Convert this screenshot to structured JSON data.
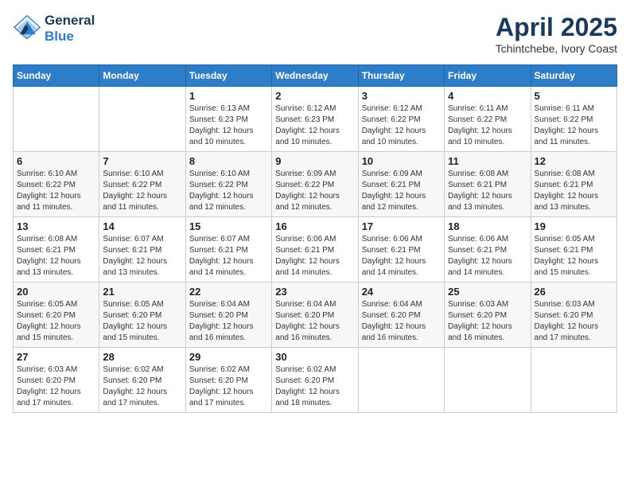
{
  "header": {
    "logo_line1": "General",
    "logo_line2": "Blue",
    "month": "April 2025",
    "location": "Tchintchebe, Ivory Coast"
  },
  "weekdays": [
    "Sunday",
    "Monday",
    "Tuesday",
    "Wednesday",
    "Thursday",
    "Friday",
    "Saturday"
  ],
  "weeks": [
    [
      {
        "day": "",
        "info": ""
      },
      {
        "day": "",
        "info": ""
      },
      {
        "day": "1",
        "info": "Sunrise: 6:13 AM\nSunset: 6:23 PM\nDaylight: 12 hours and 10 minutes."
      },
      {
        "day": "2",
        "info": "Sunrise: 6:12 AM\nSunset: 6:23 PM\nDaylight: 12 hours and 10 minutes."
      },
      {
        "day": "3",
        "info": "Sunrise: 6:12 AM\nSunset: 6:22 PM\nDaylight: 12 hours and 10 minutes."
      },
      {
        "day": "4",
        "info": "Sunrise: 6:11 AM\nSunset: 6:22 PM\nDaylight: 12 hours and 10 minutes."
      },
      {
        "day": "5",
        "info": "Sunrise: 6:11 AM\nSunset: 6:22 PM\nDaylight: 12 hours and 11 minutes."
      }
    ],
    [
      {
        "day": "6",
        "info": "Sunrise: 6:10 AM\nSunset: 6:22 PM\nDaylight: 12 hours and 11 minutes."
      },
      {
        "day": "7",
        "info": "Sunrise: 6:10 AM\nSunset: 6:22 PM\nDaylight: 12 hours and 11 minutes."
      },
      {
        "day": "8",
        "info": "Sunrise: 6:10 AM\nSunset: 6:22 PM\nDaylight: 12 hours and 12 minutes."
      },
      {
        "day": "9",
        "info": "Sunrise: 6:09 AM\nSunset: 6:22 PM\nDaylight: 12 hours and 12 minutes."
      },
      {
        "day": "10",
        "info": "Sunrise: 6:09 AM\nSunset: 6:21 PM\nDaylight: 12 hours and 12 minutes."
      },
      {
        "day": "11",
        "info": "Sunrise: 6:08 AM\nSunset: 6:21 PM\nDaylight: 12 hours and 13 minutes."
      },
      {
        "day": "12",
        "info": "Sunrise: 6:08 AM\nSunset: 6:21 PM\nDaylight: 12 hours and 13 minutes."
      }
    ],
    [
      {
        "day": "13",
        "info": "Sunrise: 6:08 AM\nSunset: 6:21 PM\nDaylight: 12 hours and 13 minutes."
      },
      {
        "day": "14",
        "info": "Sunrise: 6:07 AM\nSunset: 6:21 PM\nDaylight: 12 hours and 13 minutes."
      },
      {
        "day": "15",
        "info": "Sunrise: 6:07 AM\nSunset: 6:21 PM\nDaylight: 12 hours and 14 minutes."
      },
      {
        "day": "16",
        "info": "Sunrise: 6:06 AM\nSunset: 6:21 PM\nDaylight: 12 hours and 14 minutes."
      },
      {
        "day": "17",
        "info": "Sunrise: 6:06 AM\nSunset: 6:21 PM\nDaylight: 12 hours and 14 minutes."
      },
      {
        "day": "18",
        "info": "Sunrise: 6:06 AM\nSunset: 6:21 PM\nDaylight: 12 hours and 14 minutes."
      },
      {
        "day": "19",
        "info": "Sunrise: 6:05 AM\nSunset: 6:21 PM\nDaylight: 12 hours and 15 minutes."
      }
    ],
    [
      {
        "day": "20",
        "info": "Sunrise: 6:05 AM\nSunset: 6:20 PM\nDaylight: 12 hours and 15 minutes."
      },
      {
        "day": "21",
        "info": "Sunrise: 6:05 AM\nSunset: 6:20 PM\nDaylight: 12 hours and 15 minutes."
      },
      {
        "day": "22",
        "info": "Sunrise: 6:04 AM\nSunset: 6:20 PM\nDaylight: 12 hours and 16 minutes."
      },
      {
        "day": "23",
        "info": "Sunrise: 6:04 AM\nSunset: 6:20 PM\nDaylight: 12 hours and 16 minutes."
      },
      {
        "day": "24",
        "info": "Sunrise: 6:04 AM\nSunset: 6:20 PM\nDaylight: 12 hours and 16 minutes."
      },
      {
        "day": "25",
        "info": "Sunrise: 6:03 AM\nSunset: 6:20 PM\nDaylight: 12 hours and 16 minutes."
      },
      {
        "day": "26",
        "info": "Sunrise: 6:03 AM\nSunset: 6:20 PM\nDaylight: 12 hours and 17 minutes."
      }
    ],
    [
      {
        "day": "27",
        "info": "Sunrise: 6:03 AM\nSunset: 6:20 PM\nDaylight: 12 hours and 17 minutes."
      },
      {
        "day": "28",
        "info": "Sunrise: 6:02 AM\nSunset: 6:20 PM\nDaylight: 12 hours and 17 minutes."
      },
      {
        "day": "29",
        "info": "Sunrise: 6:02 AM\nSunset: 6:20 PM\nDaylight: 12 hours and 17 minutes."
      },
      {
        "day": "30",
        "info": "Sunrise: 6:02 AM\nSunset: 6:20 PM\nDaylight: 12 hours and 18 minutes."
      },
      {
        "day": "",
        "info": ""
      },
      {
        "day": "",
        "info": ""
      },
      {
        "day": "",
        "info": ""
      }
    ]
  ]
}
